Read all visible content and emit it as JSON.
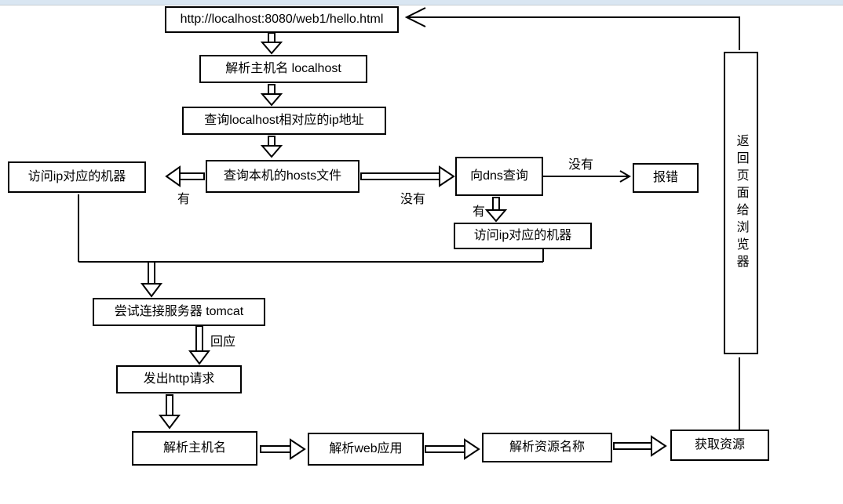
{
  "nodes": {
    "url": "http://localhost:8080/web1/hello.html",
    "parseHost": "解析主机名 localhost",
    "lookupIp": "查询localhost相对应的ip地址",
    "hostsFile": "查询本机的hosts文件",
    "accessIp1": "访问ip对应的机器",
    "dnsQuery": "向dns查询",
    "error": "报错",
    "accessIp2": "访问ip对应的机器",
    "tryTomcat": "尝试连接服务器 tomcat",
    "sendHttp": "发出http请求",
    "parseHost2": "解析主机名",
    "parseWeb": "解析web应用",
    "parseRes": "解析资源名称",
    "getRes": "获取资源",
    "returnBox": "返回页面给浏览器"
  },
  "labels": {
    "yes1": "有",
    "no1": "没有",
    "yes2": "有",
    "no2": "没有",
    "reply": "回应"
  }
}
